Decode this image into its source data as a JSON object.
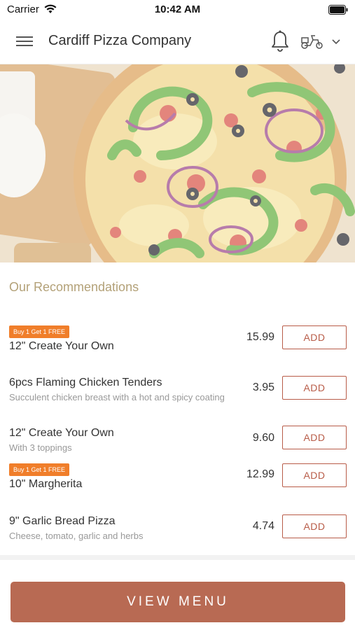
{
  "status_bar": {
    "carrier": "Carrier",
    "time": "10:42 AM"
  },
  "header": {
    "title": "Cardiff Pizza Company",
    "icons": [
      "menu-icon",
      "bell-icon",
      "scooter-icon",
      "chevron-down-icon"
    ]
  },
  "hero": {
    "image": "pizza-hero-image"
  },
  "recommendations": {
    "title": "Our Recommendations",
    "items": [
      {
        "badge": "Buy 1 Get 1 FREE",
        "name": "12\" Create Your Own",
        "description": "",
        "price": "15.99",
        "action": "ADD"
      },
      {
        "badge": "",
        "name": "6pcs Flaming Chicken Tenders",
        "description": "Succulent chicken breast with a hot and spicy coating",
        "price": "3.95",
        "action": "ADD"
      },
      {
        "badge": "",
        "name": "12\" Create Your Own",
        "description": "With 3 toppings",
        "price": "9.60",
        "action": "ADD"
      },
      {
        "badge": "Buy 1 Get 1 FREE",
        "name": "10\" Margherita",
        "description": "",
        "price": "12.99",
        "action": "ADD"
      },
      {
        "badge": "",
        "name": "9\" Garlic Bread Pizza",
        "description": "Cheese, tomato, garlic and herbs",
        "price": "4.74",
        "action": "ADD"
      }
    ]
  },
  "footer": {
    "view_menu_label": "VIEW MENU"
  },
  "colors": {
    "accent": "#b86a53",
    "badge": "#f07e2a",
    "section_title": "#b3a178"
  }
}
